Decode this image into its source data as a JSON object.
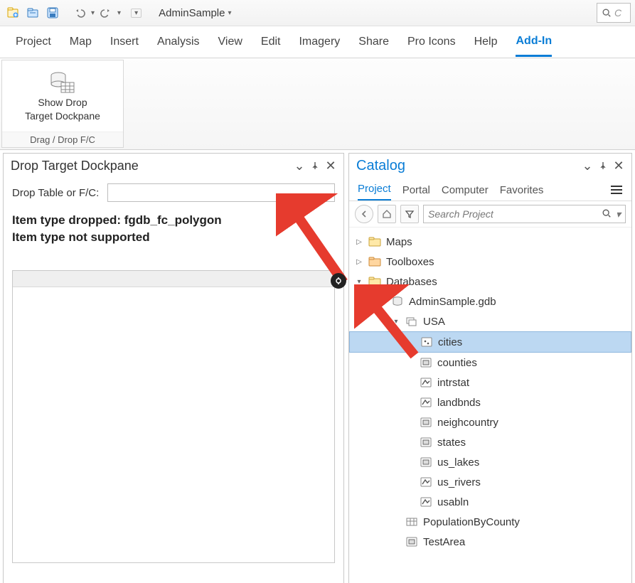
{
  "qat": {
    "project_name": "AdminSample",
    "search_placeholder": "C"
  },
  "ribbon_tabs": [
    "Project",
    "Map",
    "Insert",
    "Analysis",
    "View",
    "Edit",
    "Imagery",
    "Share",
    "Pro Icons",
    "Help",
    "Add-In"
  ],
  "ribbon_active_tab": "Add-In",
  "ribbon_group": {
    "button_line1": "Show Drop",
    "button_line2": "Target Dockpane",
    "title": "Drag / Drop F/C"
  },
  "drop_pane": {
    "title": "Drop Target Dockpane",
    "input_label": "Drop Table or F/C:",
    "input_value": "",
    "status_line1": "Item type dropped: fgdb_fc_polygon",
    "status_line2": "Item type not supported"
  },
  "catalog": {
    "title": "Catalog",
    "tabs": [
      "Project",
      "Portal",
      "Computer",
      "Favorites"
    ],
    "active_tab": "Project",
    "search_placeholder": "Search Project",
    "tree": {
      "maps": "Maps",
      "toolboxes": "Toolboxes",
      "databases": "Databases",
      "gdb": "AdminSample.gdb",
      "dataset": "USA",
      "features": [
        "cities",
        "counties",
        "intrstat",
        "landbnds",
        "neighcountry",
        "states",
        "us_lakes",
        "us_rivers",
        "usabln"
      ],
      "tables": [
        "PopulationByCounty",
        "TestArea"
      ]
    }
  }
}
